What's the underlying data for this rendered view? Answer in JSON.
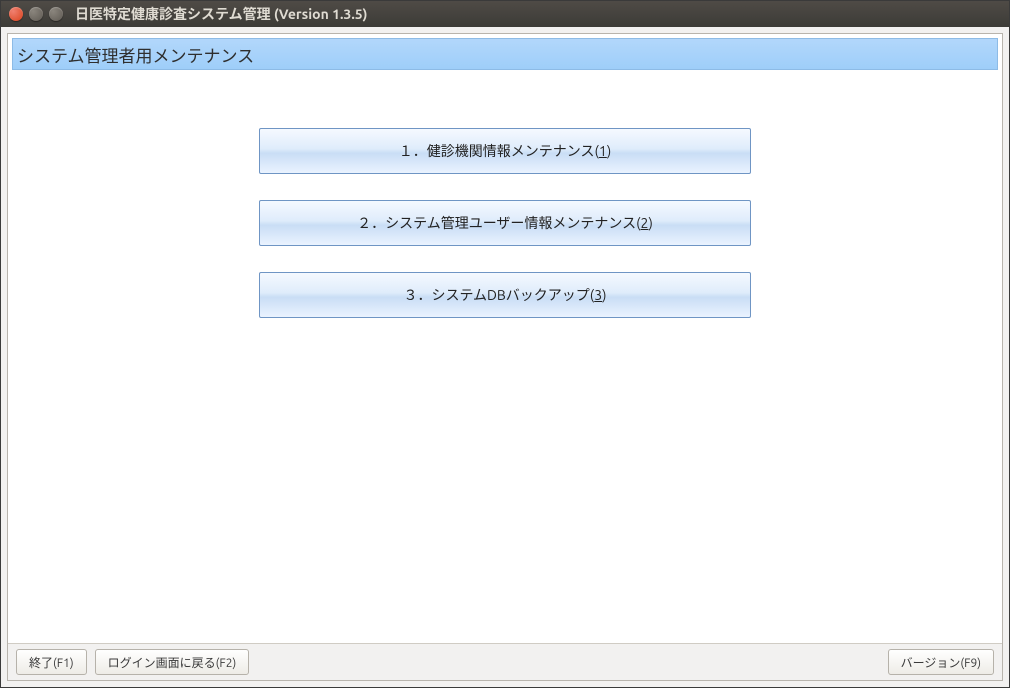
{
  "window": {
    "title": "日医特定健康診査システム管理 (Version 1.3.5)"
  },
  "header": {
    "title": "システム管理者用メンテナンス"
  },
  "menu": {
    "items": [
      {
        "prefix": "１．健診機関情報メンテナンス(",
        "hotkey": "1",
        "suffix": ")"
      },
      {
        "prefix": "２．システム管理ユーザー情報メンテナンス(",
        "hotkey": "2",
        "suffix": ")"
      },
      {
        "prefix": "３．システムDBバックアップ(",
        "hotkey": "3",
        "suffix": ")"
      }
    ]
  },
  "footer": {
    "exit": "終了(F1)",
    "back": "ログイン画面に戻る(F2)",
    "version": "バージョン(F9)"
  }
}
